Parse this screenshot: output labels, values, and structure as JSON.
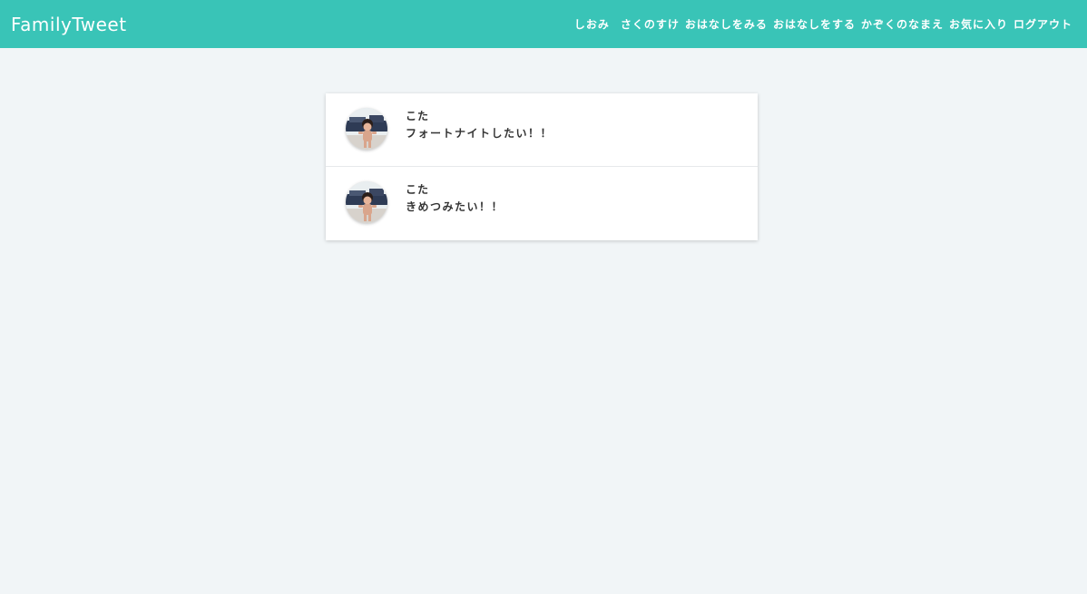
{
  "app": {
    "brand": "FamilyTweet"
  },
  "nav": {
    "user": "しおみ",
    "items": [
      {
        "label": "さくのすけ"
      },
      {
        "label": "おはなしをみる"
      },
      {
        "label": "おはなしをする"
      },
      {
        "label": "かぞくのなまえ"
      },
      {
        "label": "お気に入り"
      },
      {
        "label": "ログアウト"
      }
    ]
  },
  "feed": {
    "tweets": [
      {
        "author": "こた",
        "text": "フォートナイトしたい！！"
      },
      {
        "author": "こた",
        "text": "きめつみたい！！"
      }
    ]
  },
  "colors": {
    "navbar": "#39c4b7",
    "background": "#f1f5f7"
  }
}
